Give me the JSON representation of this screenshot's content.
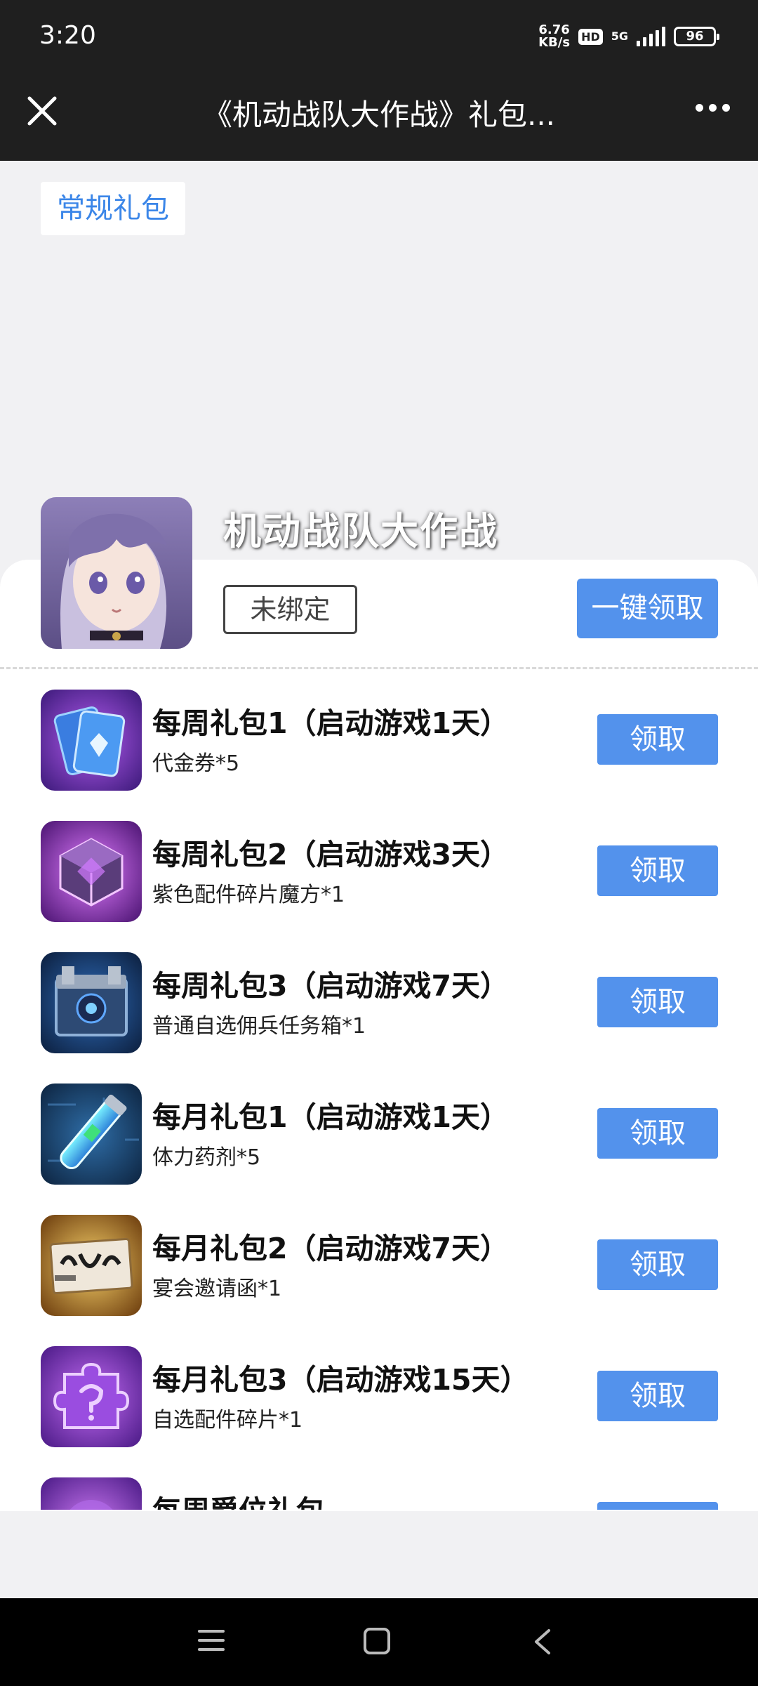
{
  "status_bar": {
    "time": "3:20",
    "net_speed_value": "6.76",
    "net_speed_unit": "KB/s",
    "hd": "HD",
    "network": "5G",
    "battery": "96"
  },
  "header": {
    "title": "《机动战队大作战》礼包..."
  },
  "tabs": {
    "active": "常规礼包"
  },
  "game": {
    "name": "机动战队大作战",
    "bind_status": "未绑定",
    "claim_all": "一键领取"
  },
  "gifts": [
    {
      "title": "每周礼包1（启动游戏1天）",
      "desc": "代金券*5",
      "claim": "领取",
      "icon": "voucher-cards-icon"
    },
    {
      "title": "每周礼包2（启动游戏3天）",
      "desc": "紫色配件碎片魔方*1",
      "claim": "领取",
      "icon": "purple-cube-icon"
    },
    {
      "title": "每周礼包3（启动游戏7天）",
      "desc": "普通自选佣兵任务箱*1",
      "claim": "领取",
      "icon": "mercenary-box-icon"
    },
    {
      "title": "每月礼包1（启动游戏1天）",
      "desc": "体力药剂*5",
      "claim": "领取",
      "icon": "stamina-potion-icon"
    },
    {
      "title": "每月礼包2（启动游戏7天）",
      "desc": "宴会邀请函*1",
      "claim": "领取",
      "icon": "banquet-invitation-icon"
    },
    {
      "title": "每月礼包3（启动游戏15天）",
      "desc": "自选配件碎片*1",
      "claim": "领取",
      "icon": "puzzle-piece-icon"
    },
    {
      "title": "每周爵位礼包",
      "desc": "",
      "claim": "领取",
      "icon": "title-gift-icon"
    }
  ],
  "colors": {
    "accent": "#5392ec",
    "tab_text": "#3b86e8",
    "topbar": "#1f1f1f"
  }
}
